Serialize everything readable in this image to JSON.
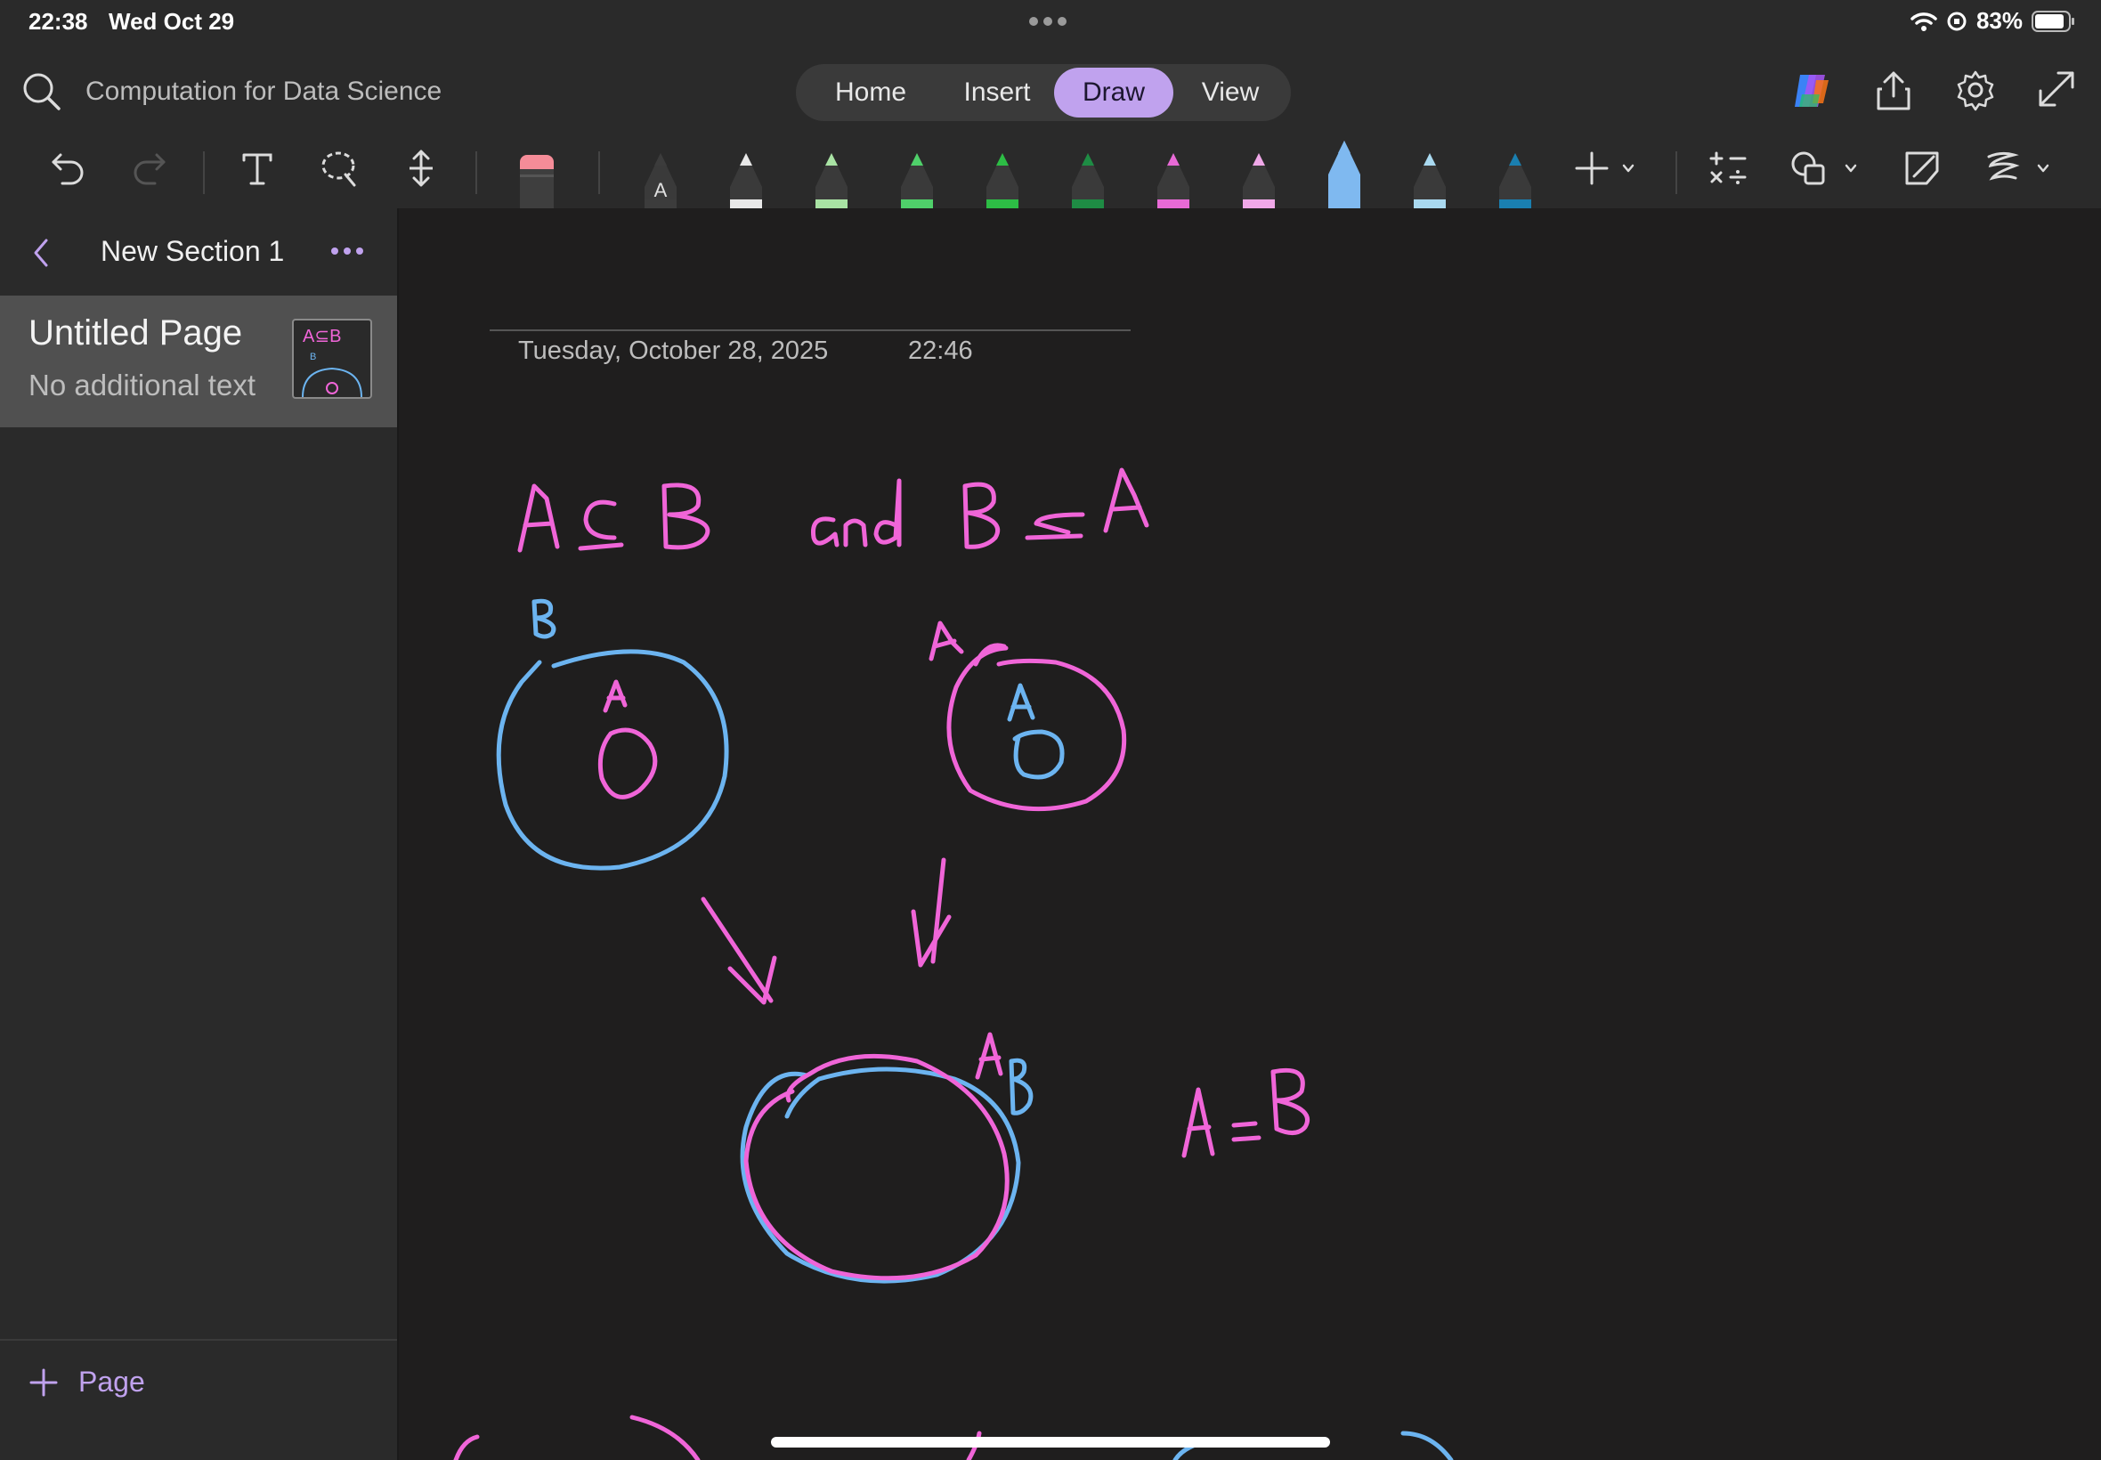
{
  "status_bar": {
    "time": "22:38",
    "date": "Wed Oct 29",
    "battery": "83%"
  },
  "title_bar": {
    "notebook_title": "Computation for Data Science",
    "tabs": [
      {
        "label": "Home",
        "active": false
      },
      {
        "label": "Insert",
        "active": false
      },
      {
        "label": "Draw",
        "active": true
      },
      {
        "label": "View",
        "active": false
      }
    ],
    "right_icons": [
      "copilot-icon",
      "share-icon",
      "settings-icon",
      "expand-icon"
    ]
  },
  "toolbar": {
    "tools": [
      "undo-icon",
      "redo-icon",
      "text-tool-icon",
      "lasso-select-icon",
      "insert-space-icon",
      "eraser-icon"
    ],
    "pens": [
      {
        "name": "pen-dark-gray",
        "color": "#3c3c3c",
        "label": "A"
      },
      {
        "name": "pen-white",
        "color": "#e8e8e8"
      },
      {
        "name": "pen-light-green",
        "color": "#a9e3a4"
      },
      {
        "name": "pen-green",
        "color": "#4fd06a"
      },
      {
        "name": "pen-bright-green",
        "color": "#2dbd45"
      },
      {
        "name": "pen-dark-green",
        "color": "#1e8c44"
      },
      {
        "name": "pen-magenta",
        "color": "#e86ad6"
      },
      {
        "name": "pen-light-pink",
        "color": "#f0a8e8"
      },
      {
        "name": "pen-light-blue",
        "color": "#7fb9f0",
        "selected": true
      },
      {
        "name": "pen-pale-blue",
        "color": "#a9d9f0"
      },
      {
        "name": "pen-teal",
        "color": "#1a7fb0"
      }
    ],
    "right_tools": [
      "add-pen-icon",
      "math-icon",
      "shapes-icon",
      "ink-to-shape-icon",
      "ink-style-icon"
    ]
  },
  "sidebar": {
    "section_name": "New Section 1",
    "pages": [
      {
        "title": "Untitled Page",
        "subtitle": "No additional text",
        "thumbnail_text": "A⊆B"
      }
    ],
    "add_page_label": "Page"
  },
  "page": {
    "date": "Tuesday, October 28, 2025",
    "time": "22:46",
    "ink_colors": {
      "pink": "#f065d8",
      "blue": "#6cb4f0"
    }
  }
}
